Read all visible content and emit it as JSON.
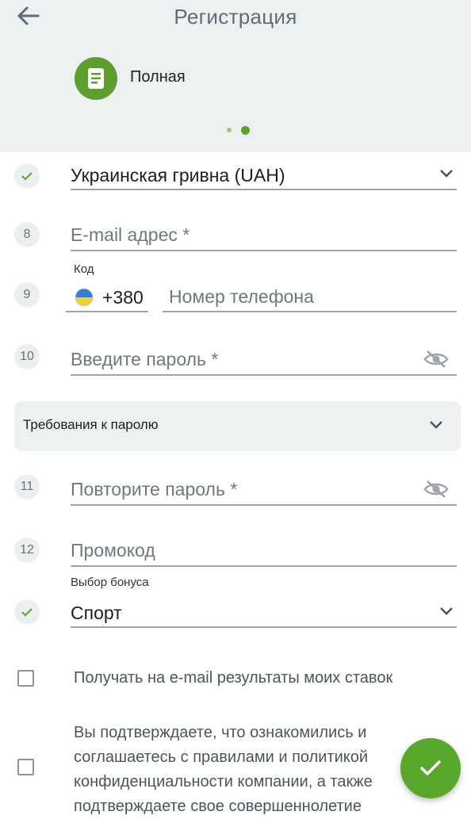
{
  "header": {
    "title": "Регистрация"
  },
  "registration_type": {
    "label": "Полная",
    "icon": "document-icon"
  },
  "pager": {
    "pages": 2,
    "active": 2
  },
  "fields": {
    "currency": {
      "value": "Украинская гривна (UAH)"
    },
    "email": {
      "number": "8",
      "placeholder": "E-mail адрес *"
    },
    "phone": {
      "number": "9",
      "code_label": "Код",
      "code_value": "+380",
      "placeholder": "Номер телефона",
      "flag": "ukraine-flag-icon"
    },
    "password": {
      "number": "10",
      "placeholder": "Введите пароль *"
    },
    "password_requirements": {
      "label": "Требования к паролю"
    },
    "repeat_password": {
      "number": "11",
      "placeholder": "Повторите пароль *"
    },
    "promo": {
      "number": "12",
      "placeholder": "Промокод"
    },
    "bonus": {
      "label": "Выбор бонуса",
      "value": "Спорт"
    }
  },
  "checkboxes": {
    "email_results": {
      "text": "Получать на e-mail результаты моих ставок",
      "checked": false
    },
    "terms": {
      "text": "Вы подтверждаете, что ознакомились и соглашаетесь с правилами и политикой конфиденциальности компании, а также подтверждаете свое совершеннолетие",
      "checked": false
    }
  },
  "colors": {
    "accent": "#5aa82b",
    "header_bg": "#edf0f1",
    "title": "#5a6e7c"
  }
}
